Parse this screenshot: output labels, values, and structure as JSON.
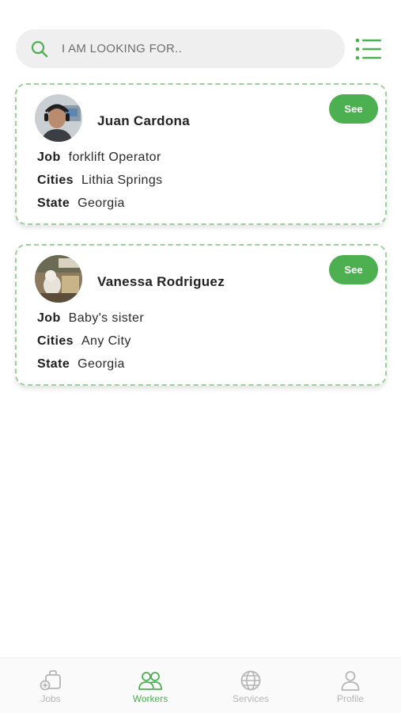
{
  "search": {
    "placeholder": "I AM LOOKING FOR.."
  },
  "workers": [
    {
      "name": "Juan Cardona",
      "see_label": "See",
      "job_label": "Job",
      "job": "forklift Operator",
      "cities_label": "Cities",
      "cities": "Lithia Springs",
      "state_label": "State",
      "state": "Georgia"
    },
    {
      "name": "Vanessa Rodriguez",
      "see_label": "See",
      "job_label": "Job",
      "job": "Baby's sister",
      "cities_label": "Cities",
      "cities": "Any City",
      "state_label": "State",
      "state": "Georgia"
    }
  ],
  "nav": {
    "items": [
      {
        "label": "Jobs",
        "icon": "briefcase-plus-icon",
        "active": false
      },
      {
        "label": "Workers",
        "icon": "users-icon",
        "active": true
      },
      {
        "label": "Services",
        "icon": "globe-icon",
        "active": false
      },
      {
        "label": "Profile",
        "icon": "user-icon",
        "active": false
      }
    ]
  },
  "colors": {
    "accent": "#4caf50",
    "card_border": "#9ccf9c",
    "search_bg": "#efefef",
    "nav_inactive": "#b5b5b5"
  }
}
